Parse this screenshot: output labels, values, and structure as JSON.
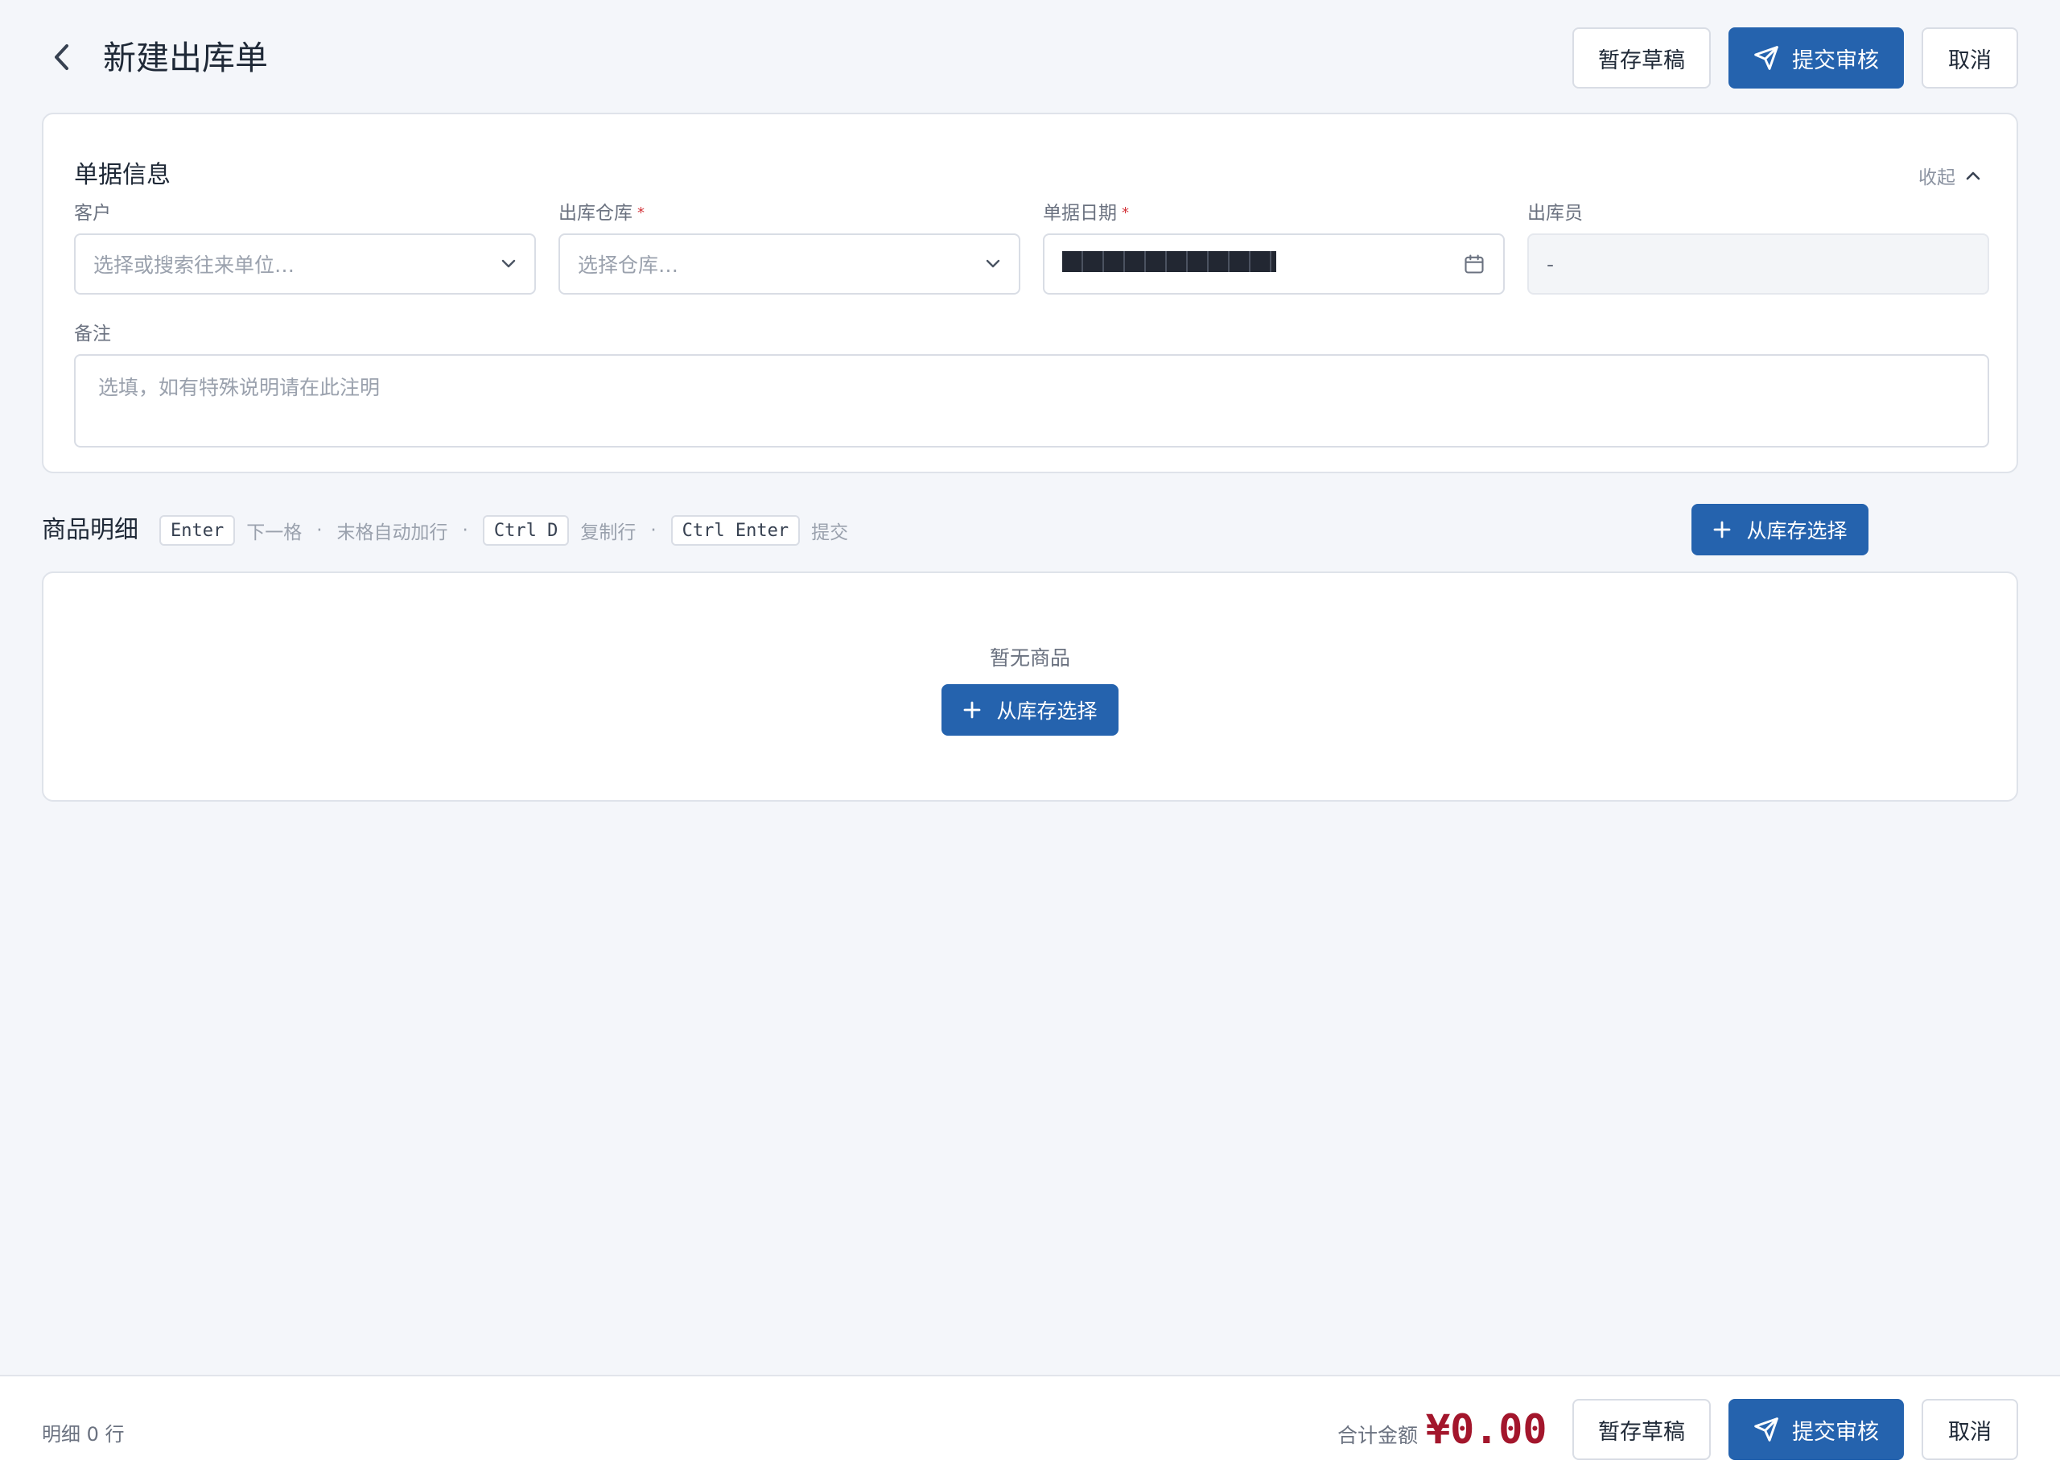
{
  "header": {
    "title": "新建出库单",
    "draft_label": "暂存草稿",
    "submit_label": "提交审核",
    "cancel_label": "取消"
  },
  "info": {
    "title": "单据信息",
    "collapse_label": "收起",
    "customer": {
      "label": "客户",
      "placeholder": "选择或搜索往来单位…"
    },
    "warehouse": {
      "label": "出库仓库",
      "required_mark": "*",
      "placeholder": "选择仓库…"
    },
    "date": {
      "label": "单据日期",
      "required_mark": "*"
    },
    "operator": {
      "label": "出库员",
      "value": "-"
    },
    "remark": {
      "label": "备注",
      "placeholder": "选填，如有特殊说明请在此注明"
    }
  },
  "details": {
    "title": "商品明细",
    "hints": [
      {
        "key": "Enter",
        "text": "下一格"
      },
      {
        "text": "末格自动加行"
      },
      {
        "key": "Ctrl D",
        "text": "复制行"
      },
      {
        "key": "Ctrl Enter",
        "text": "提交"
      }
    ],
    "separator": "·",
    "select_label": "从库存选择",
    "empty_text": "暂无商品"
  },
  "footer": {
    "count_text": "明细 0 行",
    "total_label": "合计金额",
    "total_amount": "¥0.00",
    "draft_label": "暂存草稿",
    "submit_label": "提交审核",
    "cancel_label": "取消"
  },
  "colors": {
    "primary": "#2563ae",
    "background": "#f4f6fa",
    "amount": "#a3162c",
    "required": "#d3343a"
  },
  "icons": [
    "chevron-left-icon",
    "send-icon",
    "chevron-up-icon",
    "chevron-down-icon",
    "calendar-icon",
    "plus-icon"
  ]
}
